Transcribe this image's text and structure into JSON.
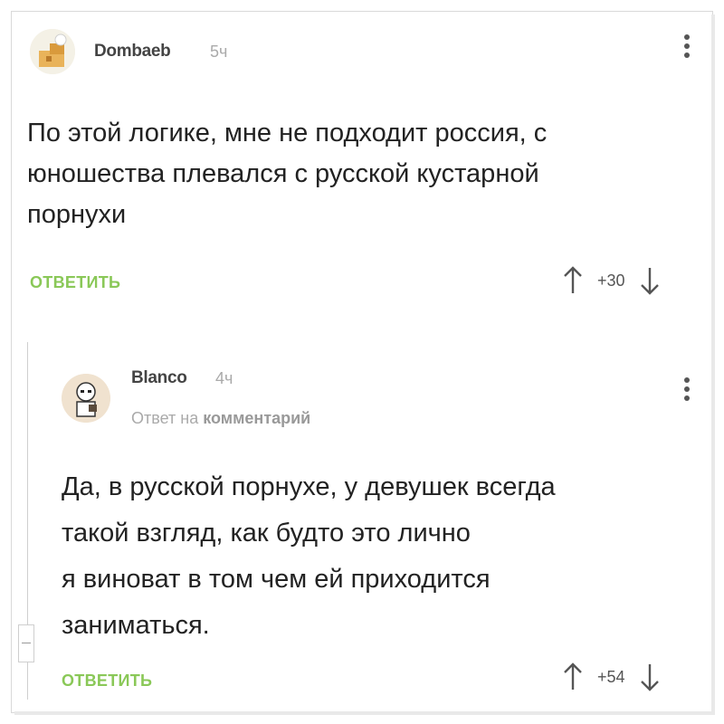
{
  "comments": [
    {
      "author": "Dombaeb",
      "time": "5ч",
      "text_lines": [
        "По этой логике, мне не подходит россия, с",
        "юношества плевался с русской кустарной",
        "порнухи"
      ],
      "reply_label": "ОТВЕТИТЬ",
      "score": "+30"
    },
    {
      "author": "Blanco",
      "time": "4ч",
      "reply_to_prefix": "Ответ на",
      "reply_to_target": "комментарий",
      "text_lines": [
        "Да, в русской порнухе, у девушек всегда",
        "такой взгляд, как будто это лично",
        "я виноват в том чем ей приходится",
        "заниматься."
      ],
      "reply_label": "ОТВЕТИТЬ",
      "score": "+54"
    }
  ],
  "colors": {
    "reply_link": "#8ac858",
    "text": "#222222",
    "muted": "#aaaaaa"
  },
  "icons": [
    "upvote-arrow-icon",
    "downvote-arrow-icon",
    "more-options-icon"
  ]
}
